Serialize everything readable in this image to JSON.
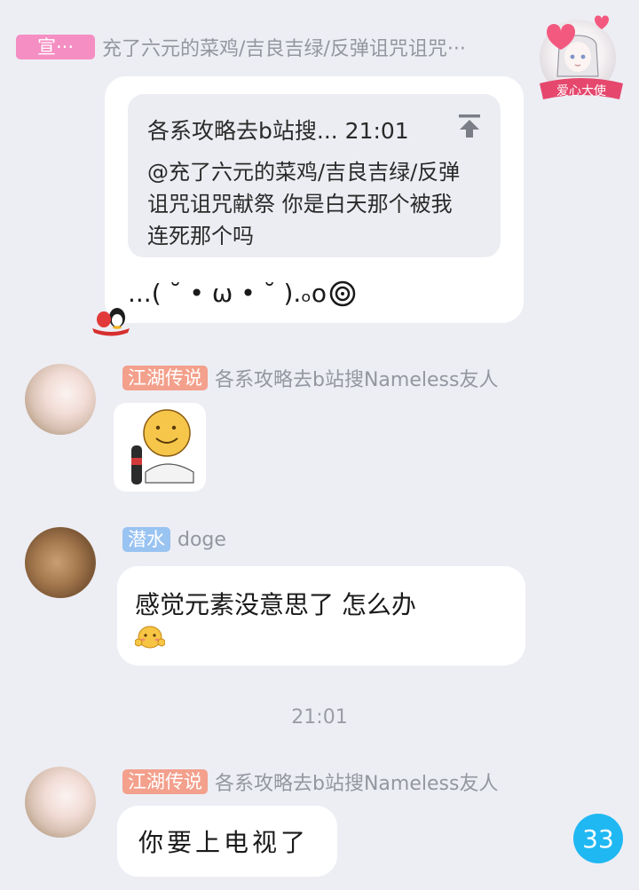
{
  "messages": [
    {
      "badge": "宣···",
      "sender": "充了六元的菜鸡/吉良吉绿/反弹诅咒诅咒···",
      "sticker_text": "爱心大使",
      "quote": {
        "header": "各系攻略去b站搜... 21:01",
        "body_line1": "@充了六元的菜鸡/吉良吉绿/反弹",
        "body_line2": "诅咒诅咒献祭 你是白天那个被我",
        "body_line3": "连死那个吗"
      },
      "text": "...( ˘ • ω • ˘ ).ₒo"
    },
    {
      "badge": "江湖传说",
      "sender": "各系攻略去b站搜Nameless友人"
    },
    {
      "badge": "潜水",
      "sender": "doge",
      "text": "感觉元素没意思了 怎么办"
    },
    {
      "badge": "江湖传说",
      "sender": "各系攻略去b站搜Nameless友人",
      "text": "你要上电视了"
    }
  ],
  "timestamp": "21:01",
  "unread_count": "33",
  "colors": {
    "background": "#edeef4",
    "badge_pink": "#f58ec2",
    "badge_orange": "#f3a08c",
    "badge_blue": "#99c3f1",
    "unread": "#1fb8f2"
  }
}
